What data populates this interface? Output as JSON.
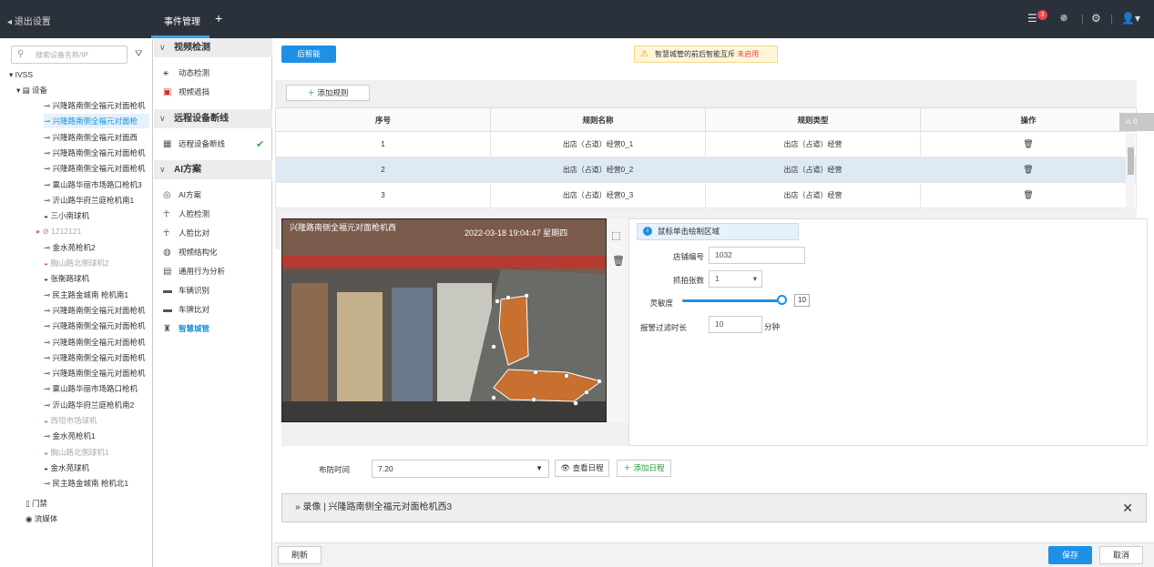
{
  "topbar": {
    "back_label": "退出设置",
    "tab_label": "事件管理",
    "add_tab": "+",
    "notification_count": "3"
  },
  "tree": {
    "search_placeholder": "搜索设备名称/IP",
    "root": "IVSS",
    "devices_label": "设备",
    "items": [
      {
        "label": "兴隆路南侧全福元对面枪机",
        "state": "normal"
      },
      {
        "label": "兴隆路南侧全福元对面枪",
        "state": "selected"
      },
      {
        "label": "兴隆路南侧全福元对面西",
        "state": "normal"
      },
      {
        "label": "兴隆路南侧全福元对面枪机",
        "state": "normal"
      },
      {
        "label": "兴隆路南侧全福元对面枪机",
        "state": "normal"
      },
      {
        "label": "粟山路华丽市场路口枪机3",
        "state": "normal"
      },
      {
        "label": "沂山路华府兰庭枪机南1",
        "state": "normal"
      },
      {
        "label": "三小南球机",
        "state": "normal"
      },
      {
        "label": "1212121",
        "state": "disabled"
      },
      {
        "label": "金水苑枪机2",
        "state": "normal"
      },
      {
        "label": "胸山路北侧球机2",
        "state": "disabled"
      },
      {
        "label": "张衡路球机",
        "state": "normal"
      },
      {
        "label": "民主路金城南 枪机南1",
        "state": "normal"
      },
      {
        "label": "兴隆路南侧全福元对面枪机",
        "state": "normal"
      },
      {
        "label": "兴隆路南侧全福元对面枪机",
        "state": "normal"
      },
      {
        "label": "兴隆路南侧全福元对面枪机",
        "state": "normal"
      },
      {
        "label": "兴隆路南侧全福元对面枪机",
        "state": "normal"
      },
      {
        "label": "兴隆路南侧全福元对面枪机",
        "state": "normal"
      },
      {
        "label": "粟山路华丽市场路口枪机",
        "state": "normal"
      },
      {
        "label": "沂山路华府兰庭枪机南2",
        "state": "normal"
      },
      {
        "label": "西坦市场球机",
        "state": "disabled"
      },
      {
        "label": "金水苑枪机1",
        "state": "normal"
      },
      {
        "label": "胸山路北侧球机1",
        "state": "disabled"
      },
      {
        "label": "金水苑球机",
        "state": "normal"
      },
      {
        "label": "民主路金城南 枪机北1",
        "state": "normal"
      }
    ],
    "door_label": "门禁",
    "stream_label": "流媒体"
  },
  "menu": {
    "video_detect": "视频检测",
    "motion": "动态检测",
    "tamper": "视频遮挡",
    "remote_offline": "远程设备断线",
    "remote_item": "远程设备断线",
    "ai_plan": "AI方案",
    "ai_items": [
      "AI方案",
      "人脸检测",
      "人脸比对",
      "视频结构化",
      "通用行为分析",
      "车辆识别",
      "车牌比对",
      "智慧城管"
    ]
  },
  "main": {
    "back_smart_btn": "后智能",
    "warning_text": "智慧城管的前后智能互斥",
    "warning_red": "未启用",
    "add_rule": "添加规则",
    "columns": [
      "序号",
      "规则名称",
      "规则类型",
      "操作"
    ],
    "rows": [
      {
        "no": "1",
        "name": "出店（占道）经营0_1",
        "type": "出店（占道）经营"
      },
      {
        "no": "2",
        "name": "出店（占道）经营0_2",
        "type": "出店（占道）经营"
      },
      {
        "no": "3",
        "name": "出店（占道）经营0_3",
        "type": "出店（占道）经营"
      }
    ],
    "alarm_count": "0",
    "video_osd_left": "兴隆路南侧全福元对面枪机西",
    "video_osd_time": "2022-03-18 19:04:47 星期四",
    "tip": "鼠标单击绘制区域",
    "store_no_label": "店铺编号",
    "store_no": "1032",
    "capture_label": "抓拍张数",
    "capture": "1",
    "sensitivity_label": "灵敏度",
    "sensitivity": "10",
    "filter_label": "报警过滤时长",
    "filter_value": "10",
    "filter_unit": "分钟",
    "schedule_label": "布防时间",
    "schedule_value": "7.20",
    "view_schedule": "查看日程",
    "add_schedule": "添加日程",
    "record_label": "» 录像 | 兴隆路南侧全福元对面枪机西3",
    "refresh": "刷新",
    "save": "保存",
    "cancel": "取消"
  }
}
